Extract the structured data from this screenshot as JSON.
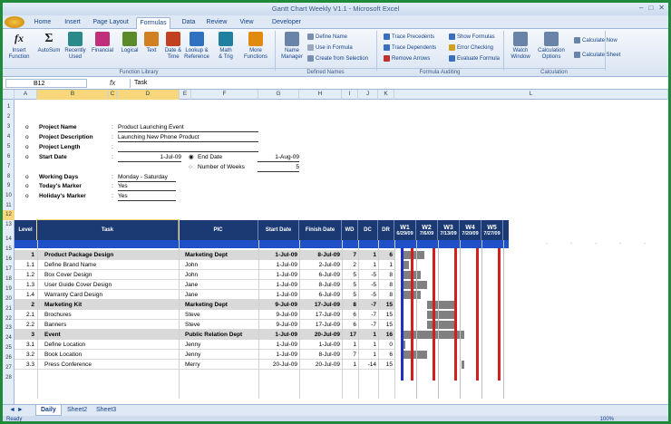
{
  "window": {
    "title": "Gantt Chart Weekly V1.1 - Microsoft Excel"
  },
  "tabs": [
    "Home",
    "Insert",
    "Page Layout",
    "Formulas",
    "Data",
    "Review",
    "View",
    "Developer"
  ],
  "active_tab": "Formulas",
  "ribbon": {
    "buttons": [
      {
        "label": "Insert\nFunction",
        "icon": "fx-icon",
        "color": "#333333"
      },
      {
        "label": "AutoSum",
        "icon": "sigma-icon",
        "color": "#333333"
      },
      {
        "label": "Recently\nUsed",
        "icon": "book-icon",
        "color": "#2a8a8a"
      },
      {
        "label": "Financial",
        "icon": "book-icon",
        "color": "#c0307a"
      },
      {
        "label": "Logical",
        "icon": "book-icon",
        "color": "#5a8a2a"
      },
      {
        "label": "Text",
        "icon": "book-icon",
        "color": "#d08020"
      },
      {
        "label": "Date &\nTime",
        "icon": "book-icon",
        "color": "#c04020"
      },
      {
        "label": "Lookup &\nReference",
        "icon": "book-icon",
        "color": "#3070c0"
      },
      {
        "label": "Math\n& Trig",
        "icon": "book-icon",
        "color": "#2080a0"
      },
      {
        "label": "More\nFunctions",
        "icon": "book-icon",
        "color": "#e08a10"
      },
      {
        "label": "Name\nManager",
        "icon": "tag-icon",
        "color": "#6a84a8"
      },
      {
        "label": "Watch\nWindow",
        "icon": "window-icon",
        "color": "#6a84a8"
      },
      {
        "label": "Calculation\nOptions",
        "icon": "calc-icon",
        "color": "#6a84a8"
      }
    ],
    "small_buttons": [
      "Define Name",
      "Use in Formula",
      "Create from Selection",
      "Trace Precedents",
      "Trace Dependents",
      "Remove Arrows",
      "Show Formulas",
      "Error Checking",
      "Evaluate Formula",
      "Calculate Now",
      "Calculate Sheet"
    ],
    "groups": [
      "Function Library",
      "Defined Names",
      "Formula Auditing",
      "Calculation"
    ]
  },
  "formula_bar": {
    "name_box": "B12",
    "fx": "fx",
    "content": "Task"
  },
  "columns": [
    "A",
    "B",
    "C",
    "D",
    "E",
    "F",
    "G",
    "H",
    "I",
    "J",
    "K",
    "L"
  ],
  "rows": [
    "1",
    "2",
    "3",
    "4",
    "5",
    "6",
    "7",
    "8",
    "9",
    "10",
    "11",
    "12",
    "13",
    "14",
    "15",
    "16",
    "17",
    "18",
    "19",
    "20",
    "21",
    "22",
    "23",
    "24",
    "25",
    "26",
    "27",
    "28"
  ],
  "project_info": [
    {
      "marker": "o",
      "label": "Project Name",
      "value": "Product Launching Event"
    },
    {
      "marker": "o",
      "label": "Project Description",
      "value": "Launching New Phone Product"
    },
    {
      "marker": "o",
      "label": "Project Length",
      "value": ""
    },
    {
      "marker": "o",
      "label": "Start Date",
      "value": "1-Jul-09"
    },
    {
      "marker": "o",
      "label": "Working Days",
      "value": "Monday - Saturday"
    },
    {
      "marker": "o",
      "label": "Today's Marker",
      "value": "Yes"
    },
    {
      "marker": "o",
      "label": "Holiday's Marker",
      "value": "Yes"
    }
  ],
  "end_date": {
    "label": "End Date",
    "value": "1-Aug-09"
  },
  "num_weeks": {
    "label": "Number of Weeks",
    "value": "5"
  },
  "table_headers": [
    "Level",
    "Task",
    "PIC",
    "Start Date",
    "Finish Date",
    "WD",
    "DC",
    "DR"
  ],
  "weeks": [
    {
      "w": "W1",
      "date": "6/29/09"
    },
    {
      "w": "W2",
      "date": "7/6/09"
    },
    {
      "w": "W3",
      "date": "7/13/09"
    },
    {
      "w": "W4",
      "date": "7/20/09"
    },
    {
      "w": "W5",
      "date": "7/27/09"
    }
  ],
  "tasks": [
    {
      "level": "1",
      "task": "Product Package Design",
      "pic": "Marketing Dept",
      "start": "1-Jul-09",
      "finish": "8-Jul-09",
      "wd": "7",
      "dc": "1",
      "dr": "6",
      "parent": true,
      "bar_from": 1,
      "bar_to": 7
    },
    {
      "level": "1.1",
      "task": "Define Brand Name",
      "pic": "John",
      "start": "1-Jul-09",
      "finish": "2-Jul-09",
      "wd": "2",
      "dc": "1",
      "dr": "1",
      "parent": false,
      "bar_from": 1,
      "bar_to": 2
    },
    {
      "level": "1.2",
      "task": "Box Cover Design",
      "pic": "John",
      "start": "1-Jul-09",
      "finish": "6-Jul-09",
      "wd": "5",
      "dc": "-5",
      "dr": "8",
      "parent": false,
      "bar_from": 1,
      "bar_to": 6
    },
    {
      "level": "1.3",
      "task": "User Guide Cover Design",
      "pic": "Jane",
      "start": "1-Jul-09",
      "finish": "8-Jul-09",
      "wd": "5",
      "dc": "-5",
      "dr": "8",
      "parent": false,
      "bar_from": 1,
      "bar_to": 8
    },
    {
      "level": "1.4",
      "task": "Warranty Card Design",
      "pic": "Jane",
      "start": "1-Jul-09",
      "finish": "6-Jul-09",
      "wd": "5",
      "dc": "-5",
      "dr": "8",
      "parent": false,
      "bar_from": 1,
      "bar_to": 6
    },
    {
      "level": "2",
      "task": "Marketing Kit",
      "pic": "Marketing Dept",
      "start": "9-Jul-09",
      "finish": "17-Jul-09",
      "wd": "8",
      "dc": "-7",
      "dr": "15",
      "parent": true,
      "bar_from": 9,
      "bar_to": 17
    },
    {
      "level": "2.1",
      "task": "Brochures",
      "pic": "Steve",
      "start": "9-Jul-09",
      "finish": "17-Jul-09",
      "wd": "6",
      "dc": "-7",
      "dr": "15",
      "parent": false,
      "bar_from": 9,
      "bar_to": 17
    },
    {
      "level": "2.2",
      "task": "Banners",
      "pic": "Steve",
      "start": "9-Jul-09",
      "finish": "17-Jul-09",
      "wd": "6",
      "dc": "-7",
      "dr": "15",
      "parent": false,
      "bar_from": 9,
      "bar_to": 17
    },
    {
      "level": "3",
      "task": "Event",
      "pic": "Public Relation Dept",
      "start": "1-Jul-09",
      "finish": "20-Jul-09",
      "wd": "17",
      "dc": "1",
      "dr": "16",
      "parent": true,
      "bar_from": 1,
      "bar_to": 20
    },
    {
      "level": "3.1",
      "task": "Define Location",
      "pic": "Jenny",
      "start": "1-Jul-09",
      "finish": "1-Jul-09",
      "wd": "1",
      "dc": "1",
      "dr": "0",
      "parent": false,
      "bar_from": 1,
      "bar_to": 1
    },
    {
      "level": "3.2",
      "task": "Book Location",
      "pic": "Jenny",
      "start": "1-Jul-09",
      "finish": "8-Jul-09",
      "wd": "7",
      "dc": "1",
      "dr": "6",
      "parent": false,
      "bar_from": 1,
      "bar_to": 8
    },
    {
      "level": "3.3",
      "task": "Press Conference",
      "pic": "Merry",
      "start": "20-Jul-09",
      "finish": "20-Jul-09",
      "wd": "1",
      "dc": "-14",
      "dr": "15",
      "parent": false,
      "bar_from": 20,
      "bar_to": 20
    }
  ],
  "sheet_tabs": [
    "Daily",
    "Sheet2",
    "Sheet3"
  ],
  "active_sheet": "Daily",
  "status": {
    "left": "Ready",
    "zoom": "100%"
  }
}
